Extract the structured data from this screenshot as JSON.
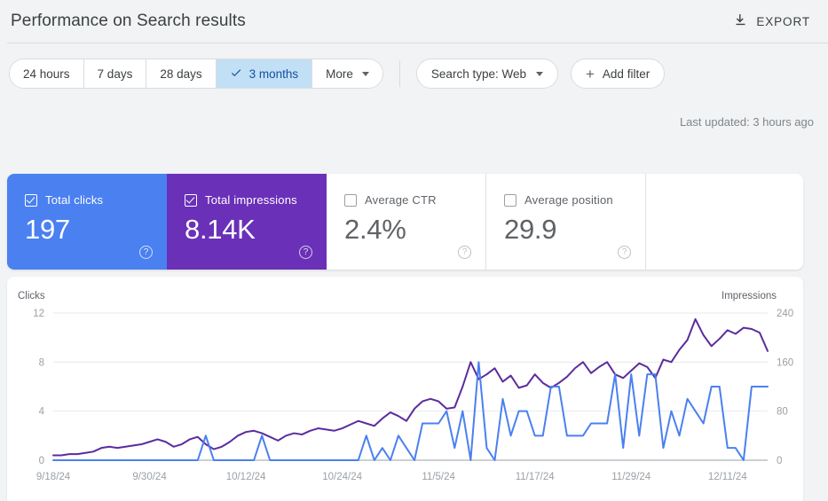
{
  "header": {
    "title": "Performance on Search results",
    "export_label": "EXPORT",
    "export_icon": "download-icon"
  },
  "filters": {
    "date_ranges": [
      {
        "label": "24 hours",
        "selected": false
      },
      {
        "label": "7 days",
        "selected": false
      },
      {
        "label": "28 days",
        "selected": false
      },
      {
        "label": "3 months",
        "selected": true
      },
      {
        "label": "More",
        "selected": false
      }
    ],
    "search_type": "Search type: Web",
    "add_filter": "Add filter",
    "last_updated": "Last updated: 3 hours ago"
  },
  "metrics": [
    {
      "label": "Total clicks",
      "value": "197",
      "checked": true,
      "color": "#4A80F0"
    },
    {
      "label": "Total impressions",
      "value": "8.14K",
      "checked": true,
      "color": "#6A30B8"
    },
    {
      "label": "Average CTR",
      "value": "2.4%",
      "checked": false,
      "color": "#E8EAED"
    },
    {
      "label": "Average position",
      "value": "29.9",
      "checked": false,
      "color": "#E8EAED"
    }
  ],
  "chart_data": {
    "type": "line",
    "title": "",
    "xlabel": "",
    "ylabel": "Clicks",
    "y2label": "Impressions",
    "grid": true,
    "legend": "none",
    "ylim": [
      0,
      12
    ],
    "y2lim": [
      0,
      240
    ],
    "yticks": [
      "0",
      "4",
      "8",
      "12"
    ],
    "y2ticks": [
      "0",
      "80",
      "160",
      "240"
    ],
    "xticks": [
      "9/18/24",
      "9/30/24",
      "10/12/24",
      "10/24/24",
      "11/5/24",
      "11/17/24",
      "11/29/24",
      "12/11/24"
    ],
    "xtick_indices": [
      0,
      12,
      24,
      36,
      48,
      60,
      72,
      84
    ],
    "x_start": "9/18/24",
    "x_end": "12/16/24",
    "n_points": 90,
    "series": [
      {
        "name": "Clicks",
        "color": "#4A80F0",
        "axis": "left",
        "values": [
          0,
          0,
          0,
          0,
          0,
          0,
          0,
          0,
          0,
          0,
          0,
          0,
          0,
          0,
          0,
          0,
          0,
          0,
          0,
          2,
          0,
          0,
          0,
          0,
          0,
          0,
          2,
          0,
          0,
          0,
          0,
          0,
          0,
          0,
          0,
          0,
          0,
          0,
          0,
          2,
          0,
          1,
          0,
          2,
          1,
          0,
          3,
          3,
          3,
          4,
          1,
          4,
          0,
          8,
          1,
          0,
          5,
          2,
          4,
          4,
          2,
          2,
          6,
          6,
          2,
          2,
          2,
          3,
          3,
          3,
          7,
          1,
          7,
          2,
          7,
          7,
          1,
          4,
          2,
          5,
          4,
          3,
          6,
          6,
          1,
          1,
          0,
          6,
          6,
          6
        ]
      },
      {
        "name": "Impressions",
        "color": "#5B2C9E",
        "axis": "right",
        "values": [
          8,
          8,
          10,
          10,
          12,
          14,
          20,
          22,
          20,
          22,
          24,
          26,
          30,
          34,
          30,
          22,
          26,
          34,
          38,
          26,
          18,
          22,
          30,
          40,
          46,
          48,
          44,
          38,
          32,
          40,
          44,
          42,
          48,
          52,
          50,
          48,
          52,
          58,
          64,
          60,
          56,
          68,
          78,
          72,
          64,
          84,
          96,
          100,
          96,
          84,
          86,
          120,
          160,
          132,
          140,
          150,
          128,
          138,
          118,
          122,
          140,
          126,
          118,
          126,
          136,
          150,
          160,
          142,
          152,
          160,
          140,
          134,
          146,
          158,
          152,
          134,
          164,
          160,
          180,
          196,
          230,
          204,
          186,
          198,
          212,
          206,
          216,
          214,
          208,
          178
        ]
      }
    ]
  }
}
